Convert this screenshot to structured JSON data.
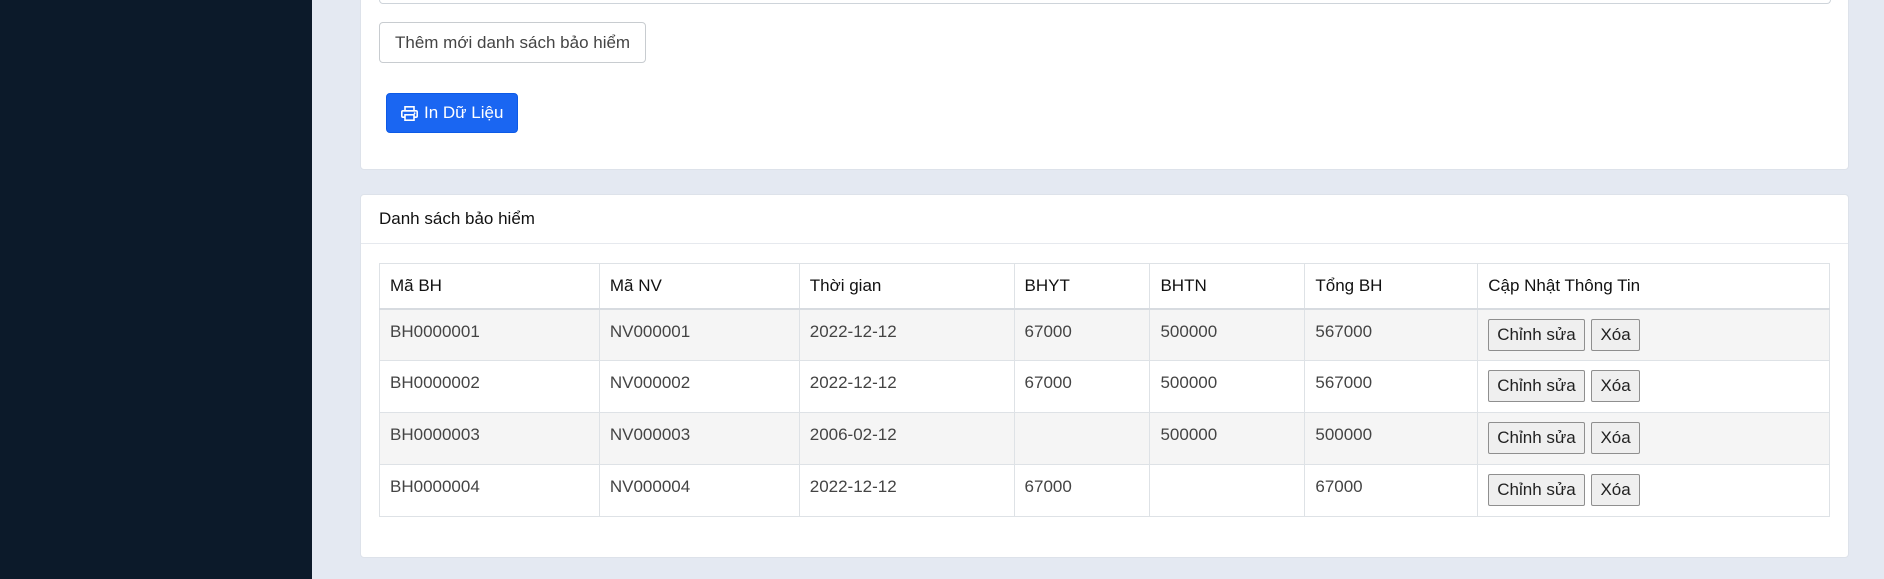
{
  "top_card": {
    "add_button_label": "Thêm mới danh sách bảo hiểm",
    "print_button_label": "In Dữ Liệu"
  },
  "list_card": {
    "title": "Danh sách bảo hiểm",
    "columns": [
      "Mã BH",
      "Mã NV",
      "Thời gian",
      "BHYT",
      "BHTN",
      "Tổng BH",
      "Cập Nhật Thông Tin"
    ],
    "rows": [
      {
        "ma_bh": "BH0000001",
        "ma_nv": "NV000001",
        "thoi_gian": "2022-12-12",
        "bhyt": "67000",
        "bhtn": "500000",
        "tong_bh": "567000"
      },
      {
        "ma_bh": "BH0000002",
        "ma_nv": "NV000002",
        "thoi_gian": "2022-12-12",
        "bhyt": "67000",
        "bhtn": "500000",
        "tong_bh": "567000"
      },
      {
        "ma_bh": "BH0000003",
        "ma_nv": "NV000003",
        "thoi_gian": "2006-02-12",
        "bhyt": "",
        "bhtn": "500000",
        "tong_bh": "500000"
      },
      {
        "ma_bh": "BH0000004",
        "ma_nv": "NV000004",
        "thoi_gian": "2022-12-12",
        "bhyt": "67000",
        "bhtn": "",
        "tong_bh": "67000"
      }
    ],
    "edit_label": "Chỉnh sửa",
    "delete_label": "Xóa"
  },
  "icons": {
    "print": "print-icon"
  },
  "colors": {
    "sidebar": "#0c1a2a",
    "background": "#e4e9f2",
    "primary": "#1a66f2"
  }
}
